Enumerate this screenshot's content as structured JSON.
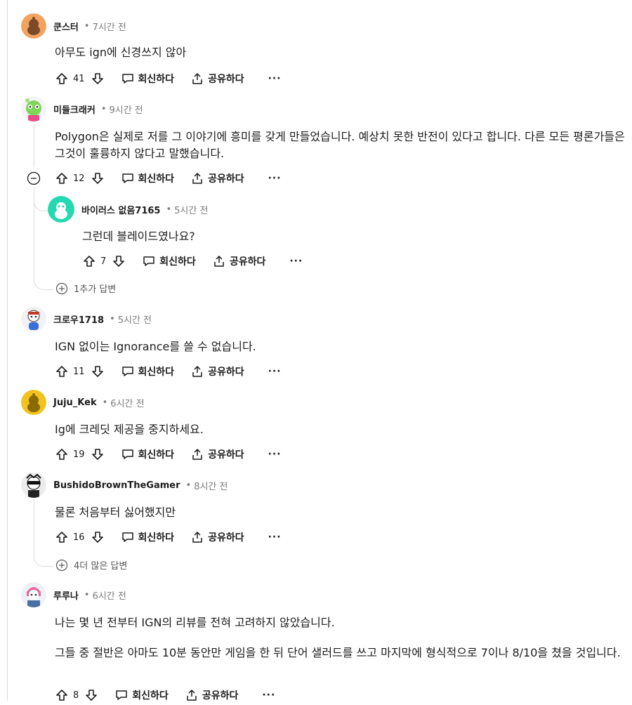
{
  "comments": [
    {
      "user": "쿤스터",
      "time": "7시간 전",
      "text": "아무도 ign에 신경쓰지 않아",
      "votes": "41",
      "avatar": "snoo-orange-icon"
    },
    {
      "user": "미들크래커",
      "time": "9시간 전",
      "text": "Polygon은 실제로 저를 그 이야기에 흥미를 갖게 만들었습니다. 예상치 못한 반전이 있다고 합니다. 다른 모든 평론가들은 그것이 훌륭하지 않다고 말했습니다.",
      "votes": "12",
      "avatar": "green-frog-avatar-icon"
    },
    {
      "user": "바이러스 없음7165",
      "time": "5시간 전",
      "text": "그런데 블레이드였나요?",
      "votes": "7",
      "avatar": "snoo-teal-icon"
    },
    {
      "user": "크로우1718",
      "time": "5시간 전",
      "text": "IGN 없이는 Ignorance를 쓸 수 없습니다.",
      "votes": "11",
      "avatar": "snoo-character-icon"
    },
    {
      "user": "Juju_Kek",
      "time": "6시간 전",
      "text": "Ig에 크레딧 제공을 중지하세요.",
      "votes": "19",
      "avatar": "snoo-yellow-icon"
    },
    {
      "user": "BushidoBrownTheGamer",
      "time": "8시간 전",
      "text": "물론 처음부터 싫어했지만",
      "votes": "16",
      "avatar": "snoo-sunglasses-icon"
    },
    {
      "user": "루루나",
      "time": "6시간 전",
      "text": "나는 몇 년 전부터 IGN의 리뷰를 전혀 고려하지 않았습니다.",
      "text2": "그들 중 절반은 아마도 10분 동안만 게임을 한 뒤 단어 샐러드를 쓰고 마지막에 형식적으로 7이나 8/10을 쳤을 것입니다.",
      "votes": "8",
      "avatar": "snoo-pink-hair-icon"
    }
  ],
  "actions": {
    "reply": "회신하다",
    "share": "공유하다",
    "more": "···"
  },
  "more_replies": [
    "1추가 답변",
    "4더 많은 답변"
  ],
  "separator": "•"
}
